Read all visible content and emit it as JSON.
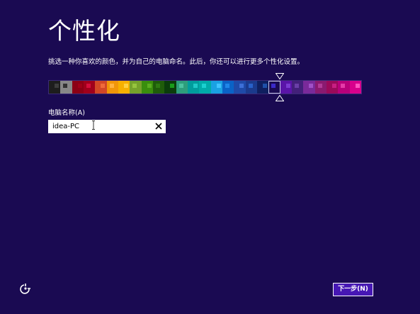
{
  "header": {
    "title": "个性化",
    "subtitle": "挑选一种你喜欢的颜色，并为自己的电脑命名。此后，你还可以进行更多个性化设置。"
  },
  "palette": {
    "selected_index": 19,
    "colors": [
      {
        "bg": "#1d1d1d",
        "accent": "#3c3c3c"
      },
      {
        "bg": "#888888",
        "accent": "#333333"
      },
      {
        "bg": "#8c0015",
        "accent": "#a00018"
      },
      {
        "bg": "#a0001b",
        "accent": "#d40d3a"
      },
      {
        "bg": "#d24726",
        "accent": "#f06a3a"
      },
      {
        "bg": "#f09609",
        "accent": "#ffb340"
      },
      {
        "bg": "#f7b000",
        "accent": "#ffd040"
      },
      {
        "bg": "#76a22b",
        "accent": "#96c43e"
      },
      {
        "bg": "#3a8e0d",
        "accent": "#5aae20"
      },
      {
        "bg": "#1f5c0a",
        "accent": "#2e7a12"
      },
      {
        "bg": "#0b3d0b",
        "accent": "#1a9a1a"
      },
      {
        "bg": "#2e9e7c",
        "accent": "#4cc2a0"
      },
      {
        "bg": "#009c9c",
        "accent": "#1fc8c8"
      },
      {
        "bg": "#00aba9",
        "accent": "#1bd0d0"
      },
      {
        "bg": "#1aa1e2",
        "accent": "#40c4ff"
      },
      {
        "bg": "#0a62c6",
        "accent": "#1f86e8"
      },
      {
        "bg": "#1f4aa8",
        "accent": "#3d6fd8"
      },
      {
        "bg": "#1b3a8c",
        "accent": "#2860c8"
      },
      {
        "bg": "#0f1f5f",
        "accent": "#1e50a8"
      },
      {
        "bg": "#1a0a52",
        "accent": "#3a2ac8"
      },
      {
        "bg": "#5a14a8",
        "accent": "#7a3ad0"
      },
      {
        "bg": "#43207a",
        "accent": "#6a3ea8"
      },
      {
        "bg": "#7a2a9a",
        "accent": "#a050c8"
      },
      {
        "bg": "#8a1a70",
        "accent": "#b03a98"
      },
      {
        "bg": "#9a0a5a",
        "accent": "#c81e82"
      },
      {
        "bg": "#b8007a",
        "accent": "#e43aa8"
      },
      {
        "bg": "#d8008c",
        "accent": "#ff54c0"
      }
    ]
  },
  "computer_name": {
    "label": "电脑名称(A)",
    "value": "idea-PC"
  },
  "footer": {
    "next_label": "下一步(N)"
  }
}
